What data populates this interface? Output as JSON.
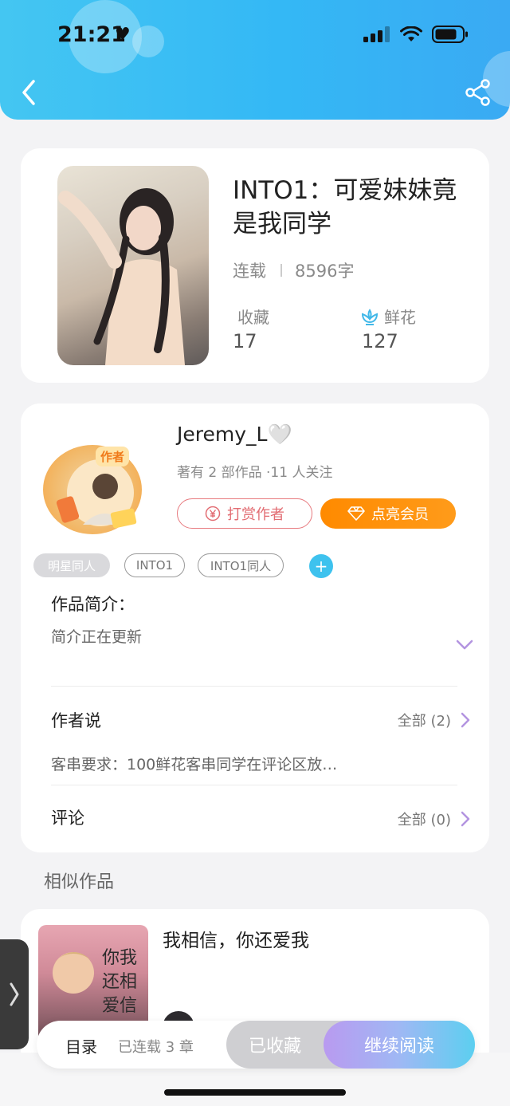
{
  "status_bar": {
    "time": "21:21",
    "heart": "♥"
  },
  "header": {
    "back_icon": "chevron-left-icon",
    "share_icon": "share-icon"
  },
  "book": {
    "title": "INTO1：可爱妹妹竟是我同学",
    "status": "连载",
    "word_count": "8596字",
    "favorites_label": "收藏",
    "favorites_value": "17",
    "flowers_label": "鲜花",
    "flowers_value": "127"
  },
  "author": {
    "name": "Jeremy_L🤍",
    "badge": "作者",
    "summary": "著有 2 部作品 ·11 人关注",
    "reward_label": "打赏作者",
    "vip_label": "点亮会员"
  },
  "tags": [
    "明星同人",
    "INTO1",
    "INTO1同人"
  ],
  "add_tag": "+",
  "intro": {
    "title": "作品简介：",
    "text": "简介正在更新"
  },
  "author_says": {
    "title": "作者说",
    "all_label": "全部 (2)",
    "text": "客串要求：100鲜花客串同学在评论区放…"
  },
  "comments": {
    "title": "评论",
    "all_label": "全部 (0)"
  },
  "similar": {
    "header": "相似作品",
    "items": [
      {
        "title": "我相信，你还爱我",
        "cover_text": "你还爱我 我相信"
      }
    ]
  },
  "bottom_bar": {
    "toc_label": "目录",
    "chapters_label": "已连载 3 章",
    "collected_label": "已收藏",
    "read_label": "继续阅读"
  },
  "colors": {
    "header_blue": "#34b8f5",
    "vip_orange": "#ff8a00",
    "reward_red": "#e26c72",
    "accent_purple": "#b99af0",
    "tag_blue": "#3ec2ee"
  }
}
